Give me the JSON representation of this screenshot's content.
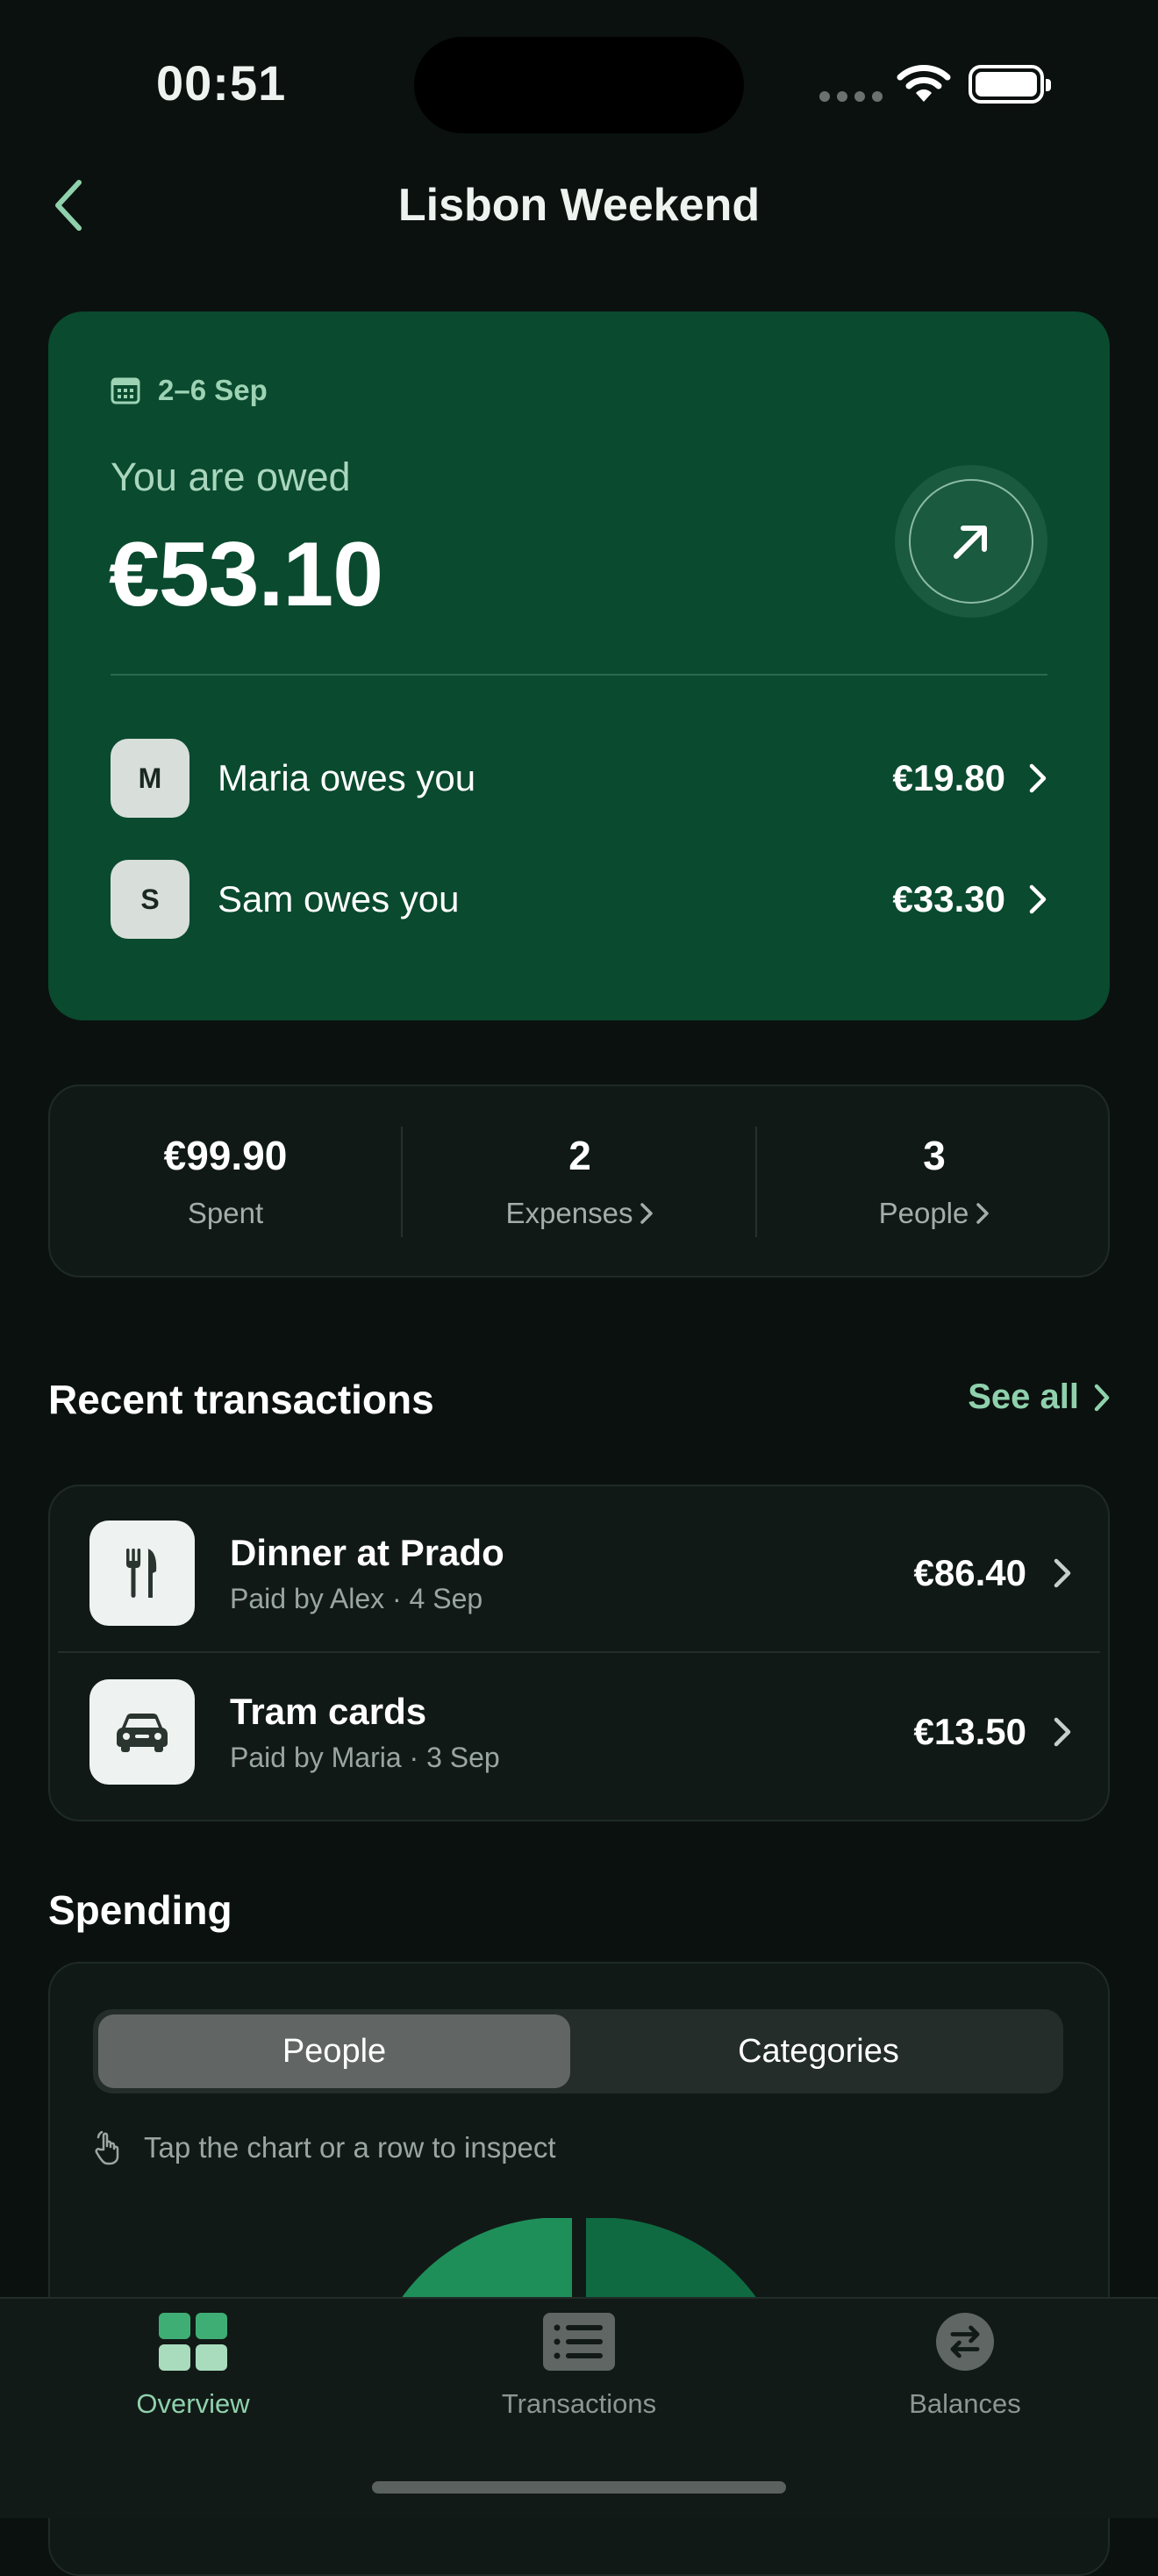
{
  "status": {
    "time": "00:51"
  },
  "nav": {
    "title": "Lisbon Weekend"
  },
  "summary": {
    "date_range": "2–6 Sep",
    "owed_label": "You are owed",
    "owed_amount": "€53.10",
    "rows": [
      {
        "initial": "M",
        "text": "Maria owes you",
        "amount": "€19.80"
      },
      {
        "initial": "S",
        "text": "Sam owes you",
        "amount": "€33.30"
      }
    ]
  },
  "stats": [
    {
      "value": "€99.90",
      "label": "Spent"
    },
    {
      "value": "2",
      "label": "Expenses"
    },
    {
      "value": "3",
      "label": "People"
    }
  ],
  "recent": {
    "title": "Recent transactions",
    "see_all": "See all",
    "items": [
      {
        "title": "Dinner at Prado",
        "subtitle": "Paid by Alex · 4 Sep",
        "amount": "€86.40",
        "icon": "fork-knife-icon"
      },
      {
        "title": "Tram cards",
        "subtitle": "Paid by Maria · 3 Sep",
        "amount": "€13.50",
        "icon": "car-icon"
      }
    ]
  },
  "spending": {
    "title": "Spending",
    "segments": [
      "People",
      "Categories"
    ],
    "selected_segment": "People",
    "hint": "Tap the chart or a row to inspect",
    "colors": {
      "slice_a": "#1f8f5a",
      "slice_b": "#0f6a42"
    }
  },
  "tabs": [
    {
      "label": "Overview",
      "icon": "grid-icon",
      "active": true
    },
    {
      "label": "Transactions",
      "icon": "list-icon",
      "active": false
    },
    {
      "label": "Balances",
      "icon": "arrows-swap-icon",
      "active": false
    }
  ],
  "colors": {
    "accent": "#8fd1ac",
    "hero_bg": "#0a4a2f",
    "background": "#0b110f"
  }
}
